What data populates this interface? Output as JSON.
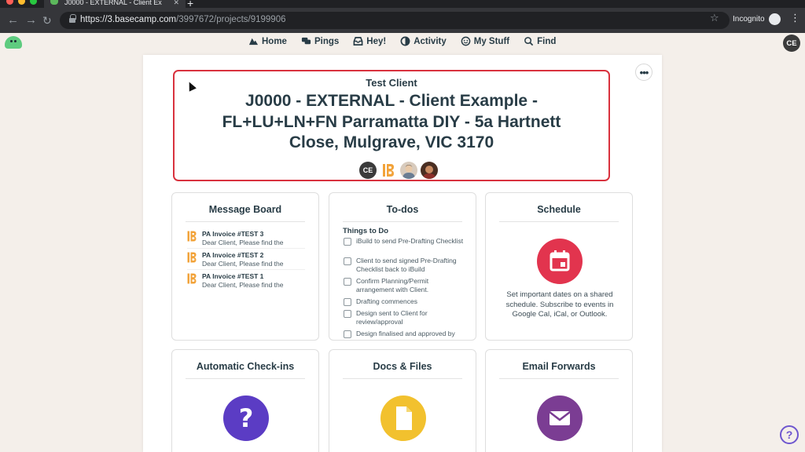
{
  "browser": {
    "tab_title": "J0000 - EXTERNAL - Client Ex",
    "url_host": "https://3.basecamp.com",
    "url_path": "/3997672/projects/9199906",
    "profile_label": "Incognito"
  },
  "nav": {
    "items": [
      {
        "label": "Home",
        "icon": "mountain-icon"
      },
      {
        "label": "Pings",
        "icon": "chat-icon"
      },
      {
        "label": "Hey!",
        "icon": "inbox-icon"
      },
      {
        "label": "Activity",
        "icon": "activity-icon"
      },
      {
        "label": "My Stuff",
        "icon": "smiley-icon"
      },
      {
        "label": "Find",
        "icon": "search-icon"
      }
    ],
    "user_initials": "CE"
  },
  "project": {
    "client": "Test Client",
    "title": "J0000 - EXTERNAL - Client Example - FL+LU+LN+FN Parramatta DIY - 5a Hartnett Close, Mulgrave, VIC 3170",
    "people": [
      {
        "initials": "CE",
        "color": "#3b3b3b"
      },
      {
        "initials": "iB",
        "color": "#f2a33a"
      },
      {
        "initials": "",
        "color": "#c9b8a5"
      },
      {
        "initials": "",
        "color": "#8a4a33"
      }
    ]
  },
  "tools": {
    "message_board": {
      "title": "Message Board",
      "messages": [
        {
          "title": "PA Invoice #TEST 3",
          "excerpt": "Dear Client, Please find the"
        },
        {
          "title": "PA Invoice #TEST 2",
          "excerpt": "Dear Client, Please find the"
        },
        {
          "title": "PA Invoice #TEST 1",
          "excerpt": "Dear Client, Please find the"
        }
      ]
    },
    "todos": {
      "title": "To-dos",
      "list_title": "Things to Do",
      "items": [
        "iBuild to send Pre-Drafting Checklist",
        "Client to send signed Pre-Drafting Checklist back to iBuild",
        "Confirm Planning/Permit arrangement with Client.",
        "Drafting commences",
        "Design sent to Client for review/approval",
        "Design finalised and approved by Client"
      ]
    },
    "schedule": {
      "title": "Schedule",
      "description": "Set important dates on a shared schedule. Subscribe to events in Google Cal, iCal, or Outlook.",
      "color": "#e2344e"
    },
    "checkins": {
      "title": "Automatic Check-ins",
      "color": "#5b3cc4"
    },
    "docs": {
      "title": "Docs & Files",
      "color": "#f2c12e"
    },
    "forwards": {
      "title": "Email Forwards",
      "color": "#7b3d93"
    }
  },
  "help_label": "?"
}
